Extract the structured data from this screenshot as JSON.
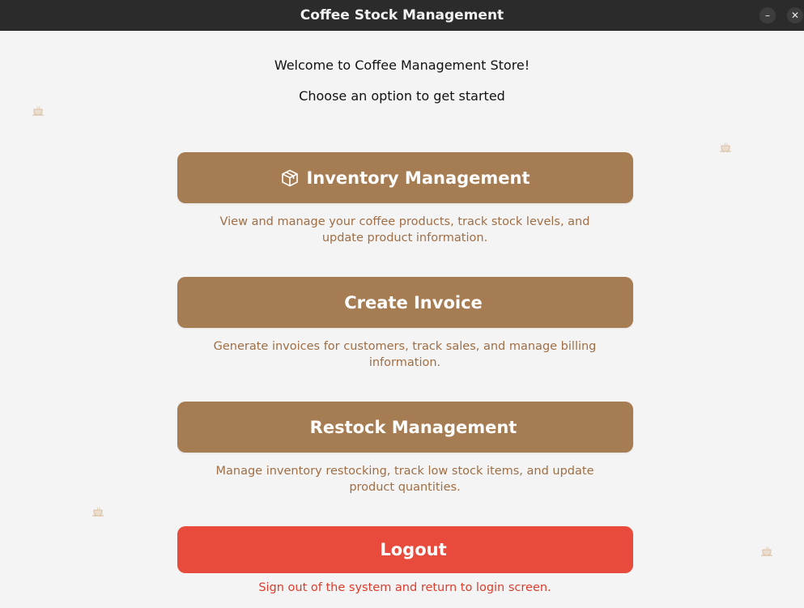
{
  "window": {
    "title": "Coffee Stock Management",
    "minimize_symbol": "–",
    "close_symbol": "✕"
  },
  "header": {
    "welcome": "Welcome to Coffee Management Store!",
    "subtitle": "Choose an option to get started"
  },
  "options": [
    {
      "label": "Inventory Management",
      "icon": "package-icon",
      "description": "View and manage your coffee products, track stock levels, and update product information."
    },
    {
      "label": "Create Invoice",
      "description": "Generate invoices for customers, track sales, and manage billing information."
    },
    {
      "label": "Restock Management",
      "description": "Manage inventory restocking, track low stock items, and update product quantities."
    }
  ],
  "logout": {
    "label": "Logout",
    "description": "Sign out of the system and return to login screen."
  },
  "colors": {
    "primary_button": "#a67c52",
    "description_text": "#a06e44",
    "logout_button": "#e84b3c",
    "logout_text": "#e03b2a",
    "titlebar": "#2b2b2b"
  },
  "decorations": {
    "icon": "coffee-cup-icon"
  }
}
